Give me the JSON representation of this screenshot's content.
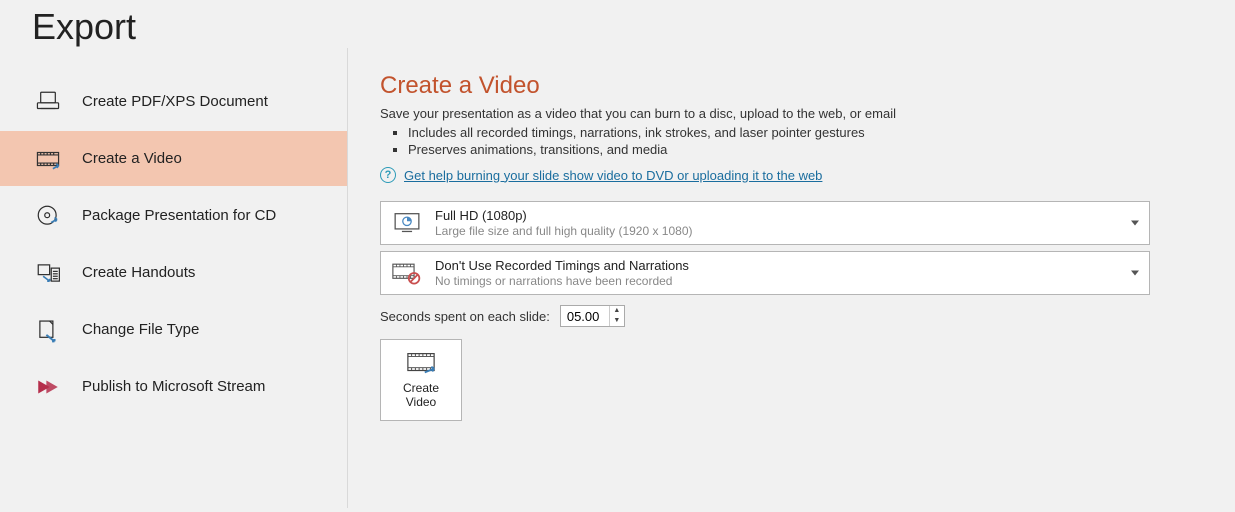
{
  "page_title": "Export",
  "sidebar": {
    "items": [
      {
        "label": "Create PDF/XPS Document"
      },
      {
        "label": "Create a Video"
      },
      {
        "label": "Package Presentation for CD"
      },
      {
        "label": "Create Handouts"
      },
      {
        "label": "Change File Type"
      },
      {
        "label": "Publish to Microsoft Stream"
      }
    ],
    "selected_index": 1
  },
  "main": {
    "title": "Create a Video",
    "description": "Save your presentation as a video that you can burn to a disc, upload to the web, or email",
    "bullets": [
      "Includes all recorded timings, narrations, ink strokes, and laser pointer gestures",
      "Preserves animations, transitions, and media"
    ],
    "help_link": "Get help burning your slide show video to DVD or uploading it to the web",
    "quality": {
      "title": "Full HD (1080p)",
      "sub": "Large file size and full high quality (1920 x 1080)"
    },
    "timings": {
      "title": "Don't Use Recorded Timings and Narrations",
      "sub": "No timings or narrations have been recorded"
    },
    "seconds_label": "Seconds spent on each slide:",
    "seconds_value": "05.00",
    "create_video_label": "Create Video"
  }
}
